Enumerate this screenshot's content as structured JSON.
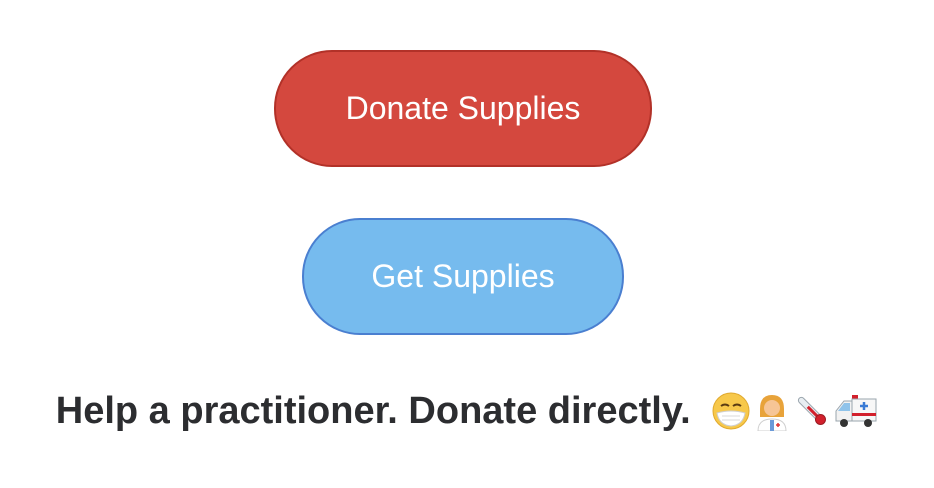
{
  "buttons": {
    "donate_label": "Donate Supplies",
    "get_label": "Get Supplies"
  },
  "tagline": {
    "text": "Help a practitioner. Donate directly.",
    "emojis": [
      "face-with-medical-mask-icon",
      "health-worker-icon",
      "thermometer-icon",
      "ambulance-icon"
    ]
  },
  "colors": {
    "donate_bg": "#d4483e",
    "donate_border": "#b23128",
    "get_bg": "#76bbee",
    "get_border": "#4a7fd0",
    "text_dark": "#2c2d30"
  }
}
